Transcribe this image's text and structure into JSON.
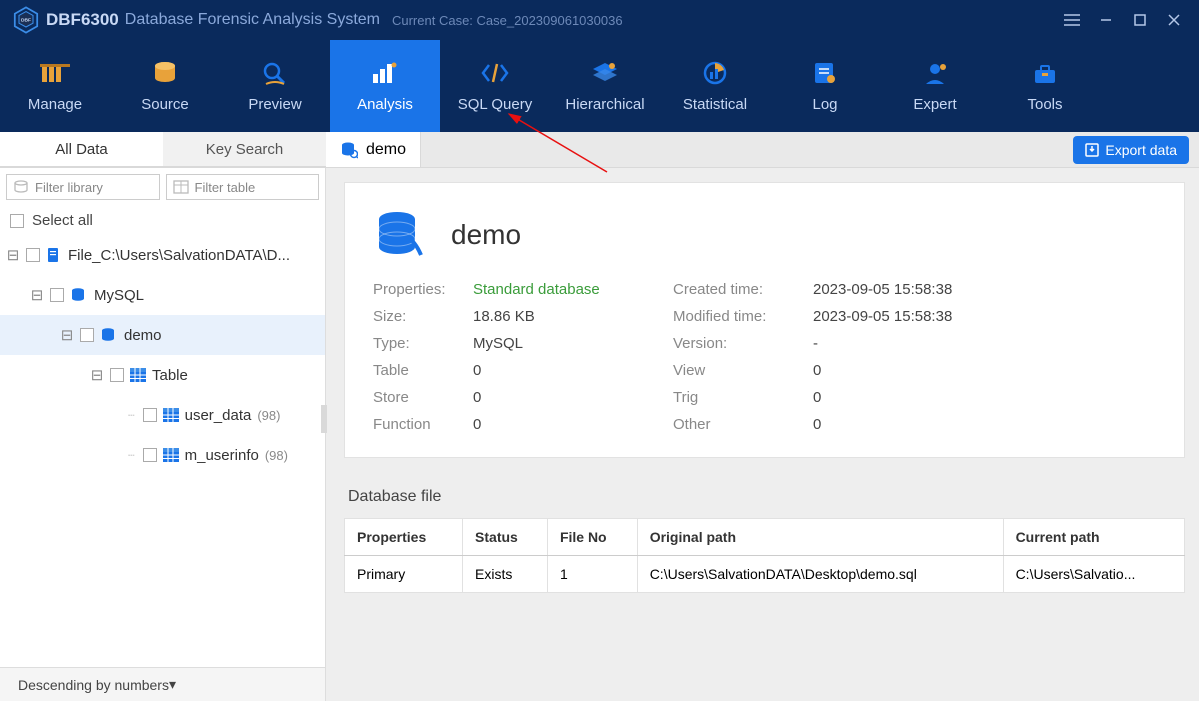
{
  "app": {
    "title": "DBF6300",
    "subtitle": "Database Forensic Analysis System",
    "case_label": "Current Case:",
    "case_value": "Case_202309061030036"
  },
  "toolbar": {
    "items": [
      {
        "label": "Manage"
      },
      {
        "label": "Source"
      },
      {
        "label": "Preview"
      },
      {
        "label": "Analysis"
      },
      {
        "label": "SQL Query"
      },
      {
        "label": "Hierarchical"
      },
      {
        "label": "Statistical"
      },
      {
        "label": "Log"
      },
      {
        "label": "Expert"
      },
      {
        "label": "Tools"
      }
    ]
  },
  "subtabs": {
    "all_data": "All Data",
    "key_search": "Key Search"
  },
  "doctab": {
    "label": "demo"
  },
  "export_label": "Export data",
  "filters": {
    "library_ph": "Filter library",
    "table_ph": "Filter table"
  },
  "select_all": "Select all",
  "tree": {
    "file": "File_C:\\Users\\SalvationDATA\\D...",
    "mysql": "MySQL",
    "demo": "demo",
    "table": "Table",
    "user_data": "user_data",
    "user_data_count": "(98)",
    "m_userinfo": "m_userinfo",
    "m_userinfo_count": "(98)"
  },
  "sort_label": "Descending by numbers",
  "db": {
    "name": "demo",
    "props": {
      "properties_k": "Properties:",
      "properties_v": "Standard database",
      "size_k": "Size:",
      "size_v": "18.86 KB",
      "type_k": "Type:",
      "type_v": "MySQL",
      "table_k": "Table",
      "table_v": "0",
      "store_k": "Store",
      "store_v": "0",
      "function_k": "Function",
      "function_v": "0",
      "created_k": "Created time:",
      "created_v": "2023-09-05 15:58:38",
      "modified_k": "Modified time:",
      "modified_v": "2023-09-05 15:58:38",
      "version_k": "Version:",
      "version_v": "-",
      "view_k": "View",
      "view_v": "0",
      "trig_k": "Trig",
      "trig_v": "0",
      "other_k": "Other",
      "other_v": "0"
    }
  },
  "files": {
    "title": "Database file",
    "headers": {
      "properties": "Properties",
      "status": "Status",
      "fileno": "File No",
      "original": "Original path",
      "current": "Current path"
    },
    "row": {
      "properties": "Primary",
      "status": "Exists",
      "fileno": "1",
      "original": "C:\\Users\\SalvationDATA\\Desktop\\demo.sql",
      "current": "C:\\Users\\Salvatio..."
    }
  }
}
